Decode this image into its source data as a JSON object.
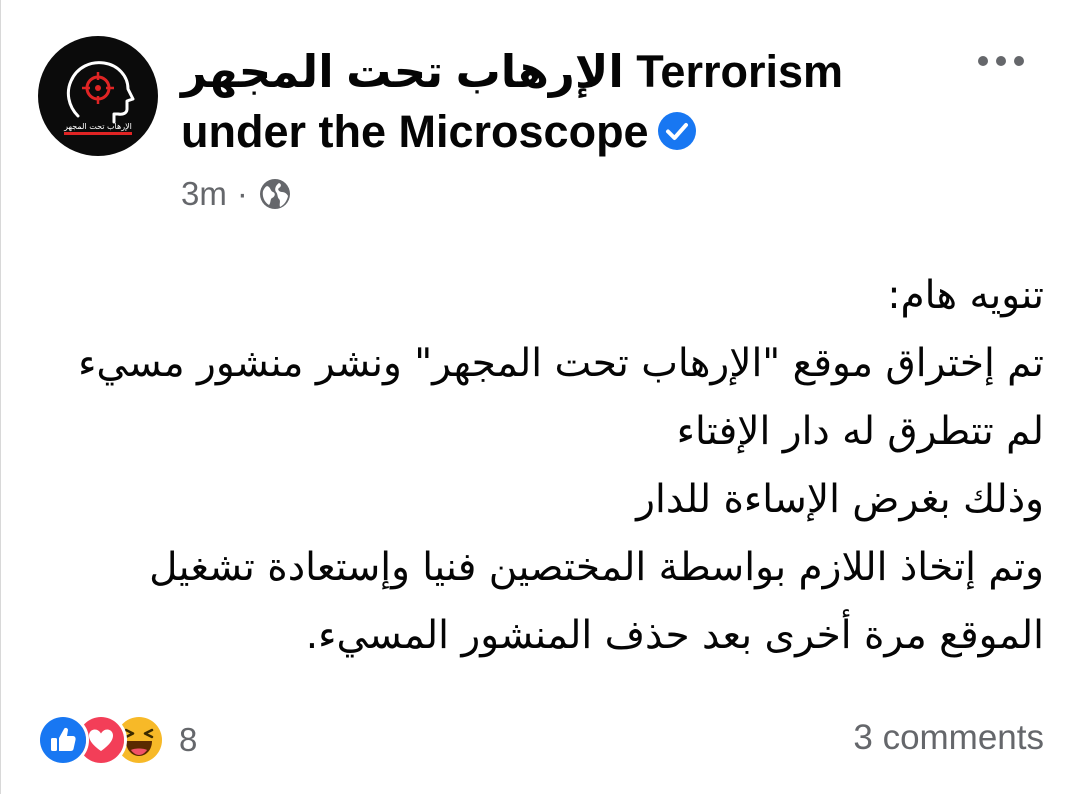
{
  "post": {
    "page_name_ar": "الإرهاب تحت المجهر",
    "page_name_en": "Terrorism under the Microscope",
    "verified": true,
    "avatar_caption": "الإرهاب تحت المجهر",
    "time": "3m",
    "separator": "·",
    "privacy_icon": "globe-icon",
    "body_lines": [
      "تنويه هام:",
      "تم إختراق موقع \"الإرهاب تحت المجهر\" ونشر منشور مسيء",
      "لم تتطرق له دار الإفتاء",
      "وذلك بغرض الإساءة للدار",
      "وتم إتخاذ اللازم بواسطة المختصين فنيا وإستعادة تشغيل",
      "الموقع مرة أخرى بعد حذف المنشور المسيء."
    ]
  },
  "reactions": {
    "types": [
      "like",
      "love",
      "haha"
    ],
    "count": "8"
  },
  "comments": {
    "label": "3 comments"
  },
  "colors": {
    "text": "#050505",
    "secondary_text": "#65676b",
    "verified_blue": "#1877f2",
    "like_blue": "#1877f2",
    "love_red": "#f33e58",
    "haha_yellow": "#f7b928",
    "avatar_bg": "#0b0b0b",
    "avatar_accent": "#e02424"
  }
}
